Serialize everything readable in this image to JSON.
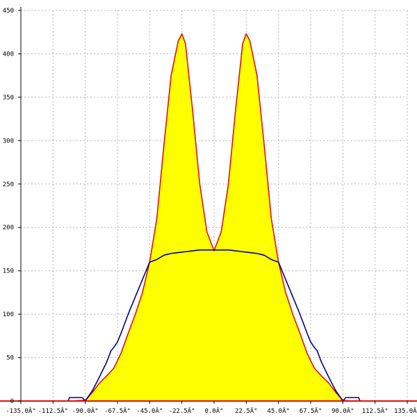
{
  "chart_data": {
    "type": "area",
    "title": "",
    "xlabel": "",
    "ylabel": "",
    "xlim": [
      -135,
      135
    ],
    "ylim": [
      0,
      450
    ],
    "grid": true,
    "x_ticks": [
      -135,
      -112.5,
      -90,
      -67.5,
      -45,
      -22.5,
      0,
      22.5,
      45,
      67.5,
      90,
      112.5,
      135
    ],
    "x_tick_labels": [
      "-135.0Â°",
      "-112.5Â°",
      "-90.0Â°",
      "-67.5Â°",
      "-45.0Â°",
      "-22.5Â°",
      "0.0Â°",
      "22.5Â°",
      "45.0Â°",
      "67.5Â°",
      "90.0Â°",
      "112.5Â°",
      "135.0Â°"
    ],
    "y_ticks": [
      0,
      50,
      100,
      150,
      200,
      250,
      300,
      350,
      400,
      450
    ],
    "y_tick_labels": [
      "0",
      "50",
      "100",
      "150",
      "200",
      "250",
      "300",
      "350",
      "400",
      "450"
    ],
    "colors": {
      "fill": "#ffff00",
      "red_line": "#e01010",
      "blue_line": "#000080",
      "grid": "#b4b4b4"
    },
    "series": [
      {
        "color": "#e01010",
        "filled": true,
        "x": [
          -135,
          -100,
          -90,
          -85,
          -80,
          -75,
          -70,
          -65,
          -60,
          -55,
          -50,
          -45,
          -40,
          -35,
          -30,
          -25,
          -22.5,
          -20,
          -15,
          -10,
          -5,
          0,
          5,
          10,
          15,
          20,
          22.5,
          25,
          30,
          35,
          40,
          45,
          50,
          55,
          60,
          65,
          70,
          75,
          80,
          85,
          90,
          95,
          135
        ],
        "y": [
          0,
          0,
          1,
          10,
          21,
          29,
          38,
          55,
          78,
          100,
          125,
          160,
          210,
          295,
          375,
          415,
          423,
          412,
          335,
          250,
          195,
          173,
          195,
          250,
          335,
          412,
          423,
          415,
          375,
          295,
          210,
          160,
          125,
          100,
          78,
          55,
          38,
          29,
          21,
          10,
          1,
          0,
          0
        ]
      },
      {
        "color": "#000080",
        "filled": false,
        "x": [
          -135,
          -102,
          -101,
          -97,
          -95,
          -92,
          -90,
          -85,
          -80,
          -75,
          -72,
          -70,
          -67.5,
          -65,
          -60,
          -55,
          -50,
          -45,
          -40,
          -35,
          -30,
          -25,
          -20,
          -15,
          -10,
          -5,
          0,
          5,
          10,
          15,
          20,
          25,
          30,
          35,
          40,
          45,
          50,
          55,
          60,
          65,
          67.5,
          70,
          72,
          75,
          80,
          85,
          90,
          92,
          95,
          97,
          101,
          102,
          135
        ],
        "y": [
          0,
          0,
          4,
          4,
          4,
          4,
          0,
          12,
          28,
          45,
          58,
          62,
          68,
          78,
          100,
          120,
          140,
          160,
          163,
          168,
          170,
          171,
          172,
          173,
          174,
          174,
          174,
          174,
          174,
          173,
          172,
          171,
          170,
          168,
          163,
          160,
          140,
          120,
          100,
          78,
          68,
          62,
          58,
          45,
          28,
          12,
          0,
          4,
          4,
          4,
          4,
          0,
          0
        ]
      }
    ]
  }
}
